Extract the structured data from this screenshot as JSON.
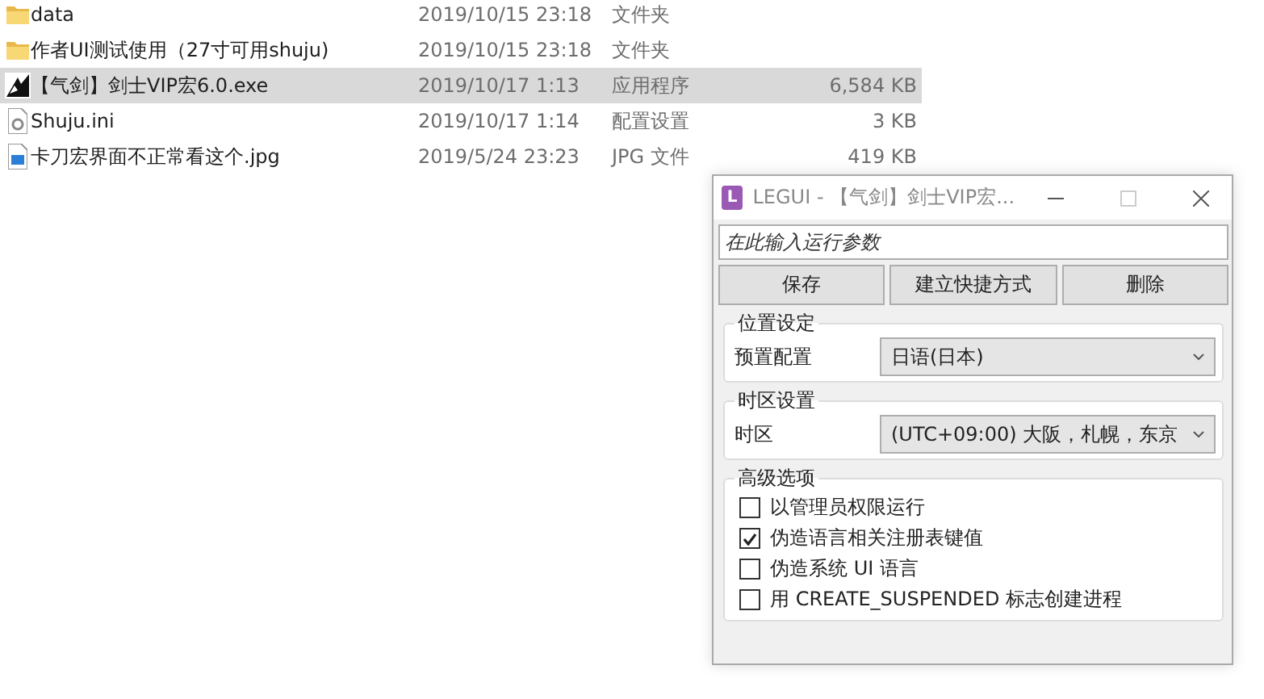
{
  "files": [
    {
      "kind": "folder",
      "name": "data",
      "modified": "2019/10/15 23:18",
      "type": "文件夹",
      "selected": false
    },
    {
      "kind": "folder",
      "name": "作者UI测试使用（27寸可用shuju)",
      "modified": "2019/10/15 23:18",
      "type": "文件夹",
      "selected": false
    },
    {
      "kind": "app",
      "name": "【气剑】剑士VIP宏6.0.exe",
      "modified": "2019/10/17 1:13",
      "type": "应用程序",
      "size": "6,584 KB",
      "selected": true
    },
    {
      "kind": "settings",
      "name": "Shuju.ini",
      "modified": "2019/10/17 1:14",
      "type": "配置设置",
      "size": "3 KB",
      "selected": false
    },
    {
      "kind": "image",
      "name": "卡刀宏界面不正常看这个.jpg",
      "modified": "2019/5/24 23:23",
      "type": "JPG 文件",
      "size": "419 KB",
      "selected": false
    }
  ],
  "dialog": {
    "app_letter": "L",
    "title": "LEGUI - 【气剑】剑士VIP宏...",
    "args_field": {
      "placeholder": "在此输入运行参数"
    },
    "buttons": [
      "保存",
      "建立快捷方式",
      "删除"
    ],
    "groups": [
      {
        "kind": "select",
        "title": "位置设定",
        "label": "预置配置",
        "value": "日语(日本)"
      },
      {
        "kind": "select",
        "title": "时区设置",
        "label": "时区",
        "value": "(UTC+09:00) 大阪，札幌，东京"
      },
      {
        "kind": "checks",
        "title": "高级选项",
        "options": [
          {
            "label": "以管理员权限运行",
            "checked": false
          },
          {
            "label": "伪造语言相关注册表键值",
            "checked": true
          },
          {
            "label": "伪造系统 UI 语言",
            "checked": false
          },
          {
            "label": "用 CREATE_SUSPENDED 标志创建进程",
            "checked": false
          }
        ]
      }
    ]
  }
}
